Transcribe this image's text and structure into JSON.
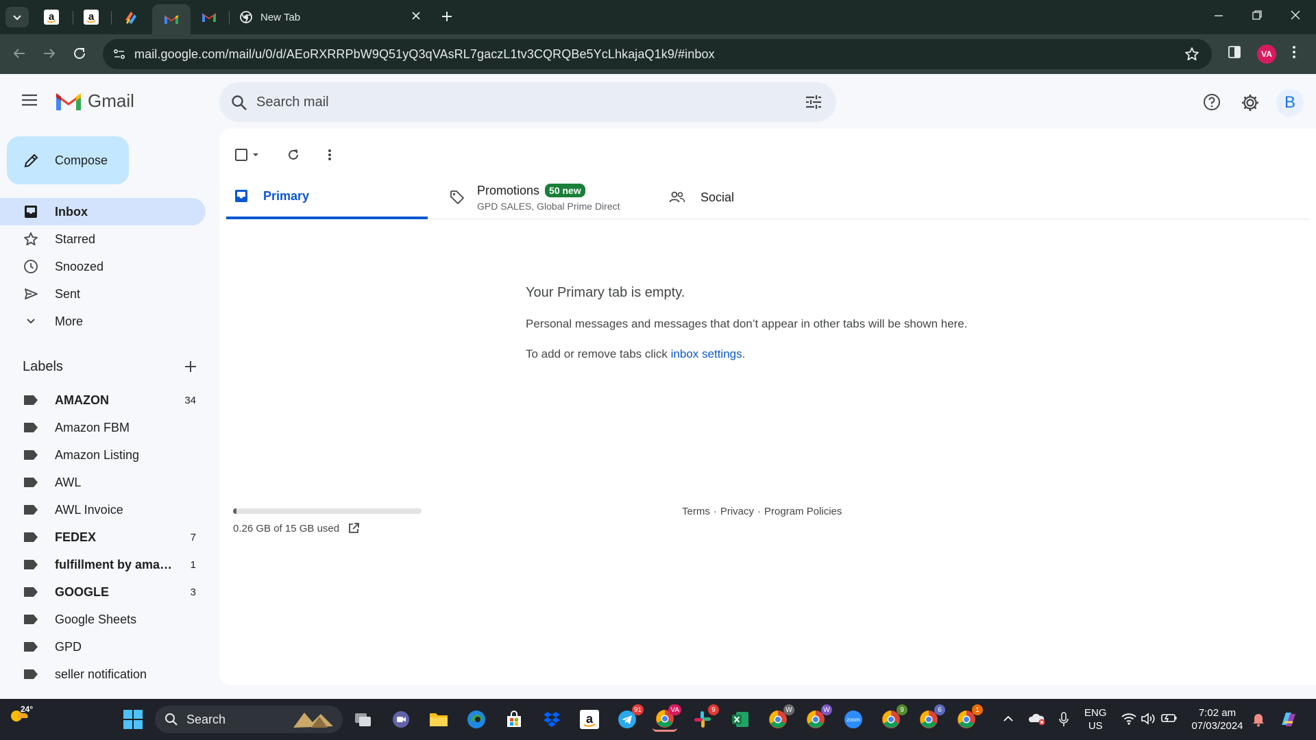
{
  "browser": {
    "tabs": [
      {
        "kind": "amazon",
        "label": "a"
      },
      {
        "kind": "amazon",
        "label": "a"
      },
      {
        "kind": "app"
      },
      {
        "kind": "gmail",
        "active": true
      },
      {
        "kind": "gmail"
      },
      {
        "kind": "newtab",
        "title": "New Tab"
      }
    ],
    "url": "mail.google.com/mail/u/0/d/AEoRXRRPbW9Q51yQ3qVAsRL7gaczL1tv3CQRQBe5YcLhkajaQ1k9/#inbox",
    "profile_initials": "VA"
  },
  "gmail": {
    "product_name": "Gmail",
    "search_placeholder": "Search mail",
    "account_initial": "B",
    "compose_label": "Compose",
    "nav": [
      {
        "label": "Inbox",
        "icon": "inbox-icon",
        "active": true
      },
      {
        "label": "Starred",
        "icon": "star-icon"
      },
      {
        "label": "Snoozed",
        "icon": "clock-icon"
      },
      {
        "label": "Sent",
        "icon": "send-icon"
      },
      {
        "label": "More",
        "icon": "chevron-down-icon"
      }
    ],
    "labels_heading": "Labels",
    "labels": [
      {
        "name": "AMAZON",
        "count": "34",
        "bold": true
      },
      {
        "name": "Amazon FBM",
        "count": ""
      },
      {
        "name": "Amazon Listing",
        "count": ""
      },
      {
        "name": "AWL",
        "count": ""
      },
      {
        "name": "AWL Invoice",
        "count": ""
      },
      {
        "name": "FEDEX",
        "count": "7",
        "bold": true
      },
      {
        "name": "fulfillment by amazon",
        "count": "1",
        "bold": true
      },
      {
        "name": "GOOGLE",
        "count": "3",
        "bold": true
      },
      {
        "name": "Google Sheets",
        "count": ""
      },
      {
        "name": "GPD",
        "count": ""
      },
      {
        "name": "seller notification",
        "count": ""
      }
    ],
    "category_tabs": {
      "primary": "Primary",
      "promotions": {
        "title": "Promotions",
        "badge": "50 new",
        "subtitle": "GPD SALES, Global Prime Direct"
      },
      "social": "Social"
    },
    "empty_state": {
      "title": "Your Primary tab is empty.",
      "line1": "Personal messages and messages that don’t appear in other tabs will be shown here.",
      "line2_prefix": "To add or remove tabs click ",
      "line2_link": "inbox settings",
      "line2_suffix": "."
    },
    "storage": {
      "text": "0.26 GB of 15 GB used",
      "used_fraction": 0.017
    },
    "footer_links": [
      "Terms",
      "·",
      "Privacy",
      "·",
      "Program Policies"
    ]
  },
  "taskbar": {
    "weather_temp": "24°",
    "search_label": "Search",
    "badges": {
      "telegram": "91",
      "chrome_va": "VA",
      "slack": "9",
      "chrome_w1": "W",
      "chrome_w2": "W",
      "chrome_9": "9",
      "chrome_6": "6",
      "chrome_1": "1"
    },
    "zoom_label": "zoom",
    "language": "ENG",
    "region": "US",
    "time": "7:02 am",
    "date": "07/03/2024"
  },
  "colors": {
    "accent": "#0b57d0",
    "compose": "#c2e7ff",
    "active_nav": "#d3e3fd",
    "promo_badge": "#188038",
    "chrome_frame": "#1c2b28"
  }
}
